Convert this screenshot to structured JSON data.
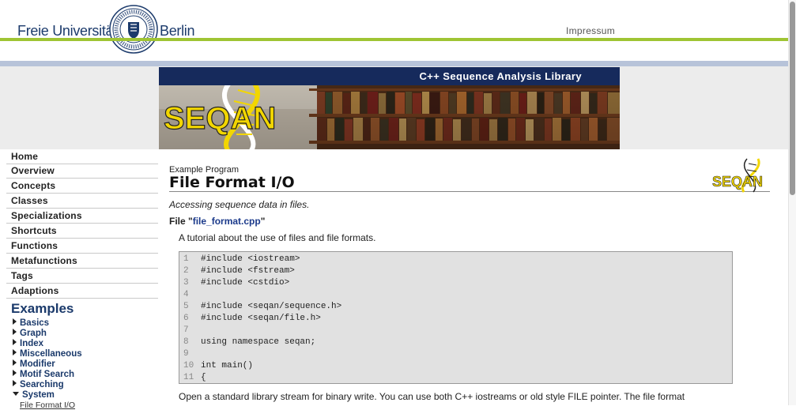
{
  "header": {
    "university_left": "Freie Universität",
    "university_right": "Berlin",
    "impressum": "Impressum"
  },
  "banner": {
    "title": "C++ Sequence Analysis Library",
    "logo_text": "SEQAN"
  },
  "sidebar": {
    "items": [
      {
        "label": "Home"
      },
      {
        "label": "Overview"
      },
      {
        "label": "Concepts"
      },
      {
        "label": "Classes"
      },
      {
        "label": "Specializations"
      },
      {
        "label": "Shortcuts"
      },
      {
        "label": "Functions"
      },
      {
        "label": "Metafunctions"
      },
      {
        "label": "Tags"
      },
      {
        "label": "Adaptions"
      }
    ],
    "examples_heading": "Examples",
    "example_categories": [
      {
        "label": "Basics",
        "expanded": false
      },
      {
        "label": "Graph",
        "expanded": false
      },
      {
        "label": "Index",
        "expanded": false
      },
      {
        "label": "Miscellaneous",
        "expanded": false
      },
      {
        "label": "Modifier",
        "expanded": false
      },
      {
        "label": "Motif Search",
        "expanded": false
      },
      {
        "label": "Searching",
        "expanded": false
      },
      {
        "label": "System",
        "expanded": true
      }
    ],
    "system_sub_item": "File Format I/O"
  },
  "main": {
    "eyebrow": "Example Program",
    "title": "File Format I/O",
    "tagline": "Accessing sequence data in files.",
    "file_prefix": "File \"",
    "file_name": "file_format.cpp",
    "file_suffix": "\"",
    "intro": "A tutorial about the use of files and file formats.",
    "code_lines": [
      {
        "num": "1",
        "text": "#include <iostream>"
      },
      {
        "num": "2",
        "text": "#include <fstream>"
      },
      {
        "num": "3",
        "text": "#include <cstdio>"
      },
      {
        "num": "4",
        "text": ""
      },
      {
        "num": "5",
        "text": "#include <seqan/sequence.h>"
      },
      {
        "num": "6",
        "text": "#include <seqan/file.h>"
      },
      {
        "num": "7",
        "text": ""
      },
      {
        "num": "8",
        "text": "using namespace seqan;"
      },
      {
        "num": "9",
        "text": ""
      },
      {
        "num": "10",
        "text": "int main()"
      },
      {
        "num": "11",
        "text": "{"
      }
    ],
    "paragraph": "Open a standard library stream for binary write. You can use both C++ iostreams or old style FILE pointer. The file format"
  },
  "colors": {
    "fu_blue": "#1b3a6b",
    "green_line": "#9fc433",
    "banner_bar": "#162a5c",
    "seqan_yellow": "#f2d600"
  }
}
